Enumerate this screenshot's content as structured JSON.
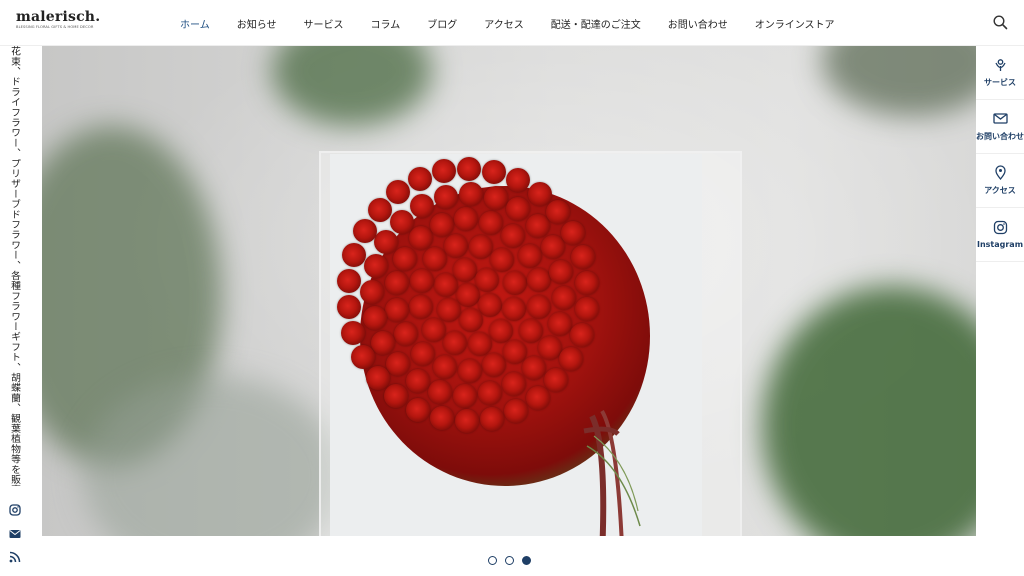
{
  "brand": {
    "name": "malerisch.",
    "tagline_small": "BLESSING FLORAL GIFTS & HOME DECOR"
  },
  "nav": {
    "items": [
      {
        "label": "ホーム",
        "active": true
      },
      {
        "label": "お知らせ",
        "active": false
      },
      {
        "label": "サービス",
        "active": false
      },
      {
        "label": "コラム",
        "active": false
      },
      {
        "label": "ブログ",
        "active": false
      },
      {
        "label": "アクセス",
        "active": false
      },
      {
        "label": "配送・配達のご注文",
        "active": false
      },
      {
        "label": "お問い合わせ",
        "active": false
      },
      {
        "label": "オンラインストア",
        "active": false
      }
    ]
  },
  "left_rail": {
    "vertical_text": "花束、ドライフラワー、プリザーブドフラワー、各種フラワーギフト、胡蝶蘭、観葉植物等を販売して",
    "icons": [
      "instagram-icon",
      "mail-icon",
      "rss-icon"
    ]
  },
  "right_rail": {
    "items": [
      {
        "label": "サービス",
        "icon": "flower-icon"
      },
      {
        "label": "お問い合わせ",
        "icon": "mail-icon"
      },
      {
        "label": "アクセス",
        "icon": "map-pin-icon"
      },
      {
        "label": "Instagram",
        "icon": "instagram-icon"
      }
    ]
  },
  "slider": {
    "total": 3,
    "active_index": 2
  },
  "colors": {
    "accent": "#1f3f66",
    "nav_active": "#1f4f82",
    "rose": "#b4160f"
  }
}
